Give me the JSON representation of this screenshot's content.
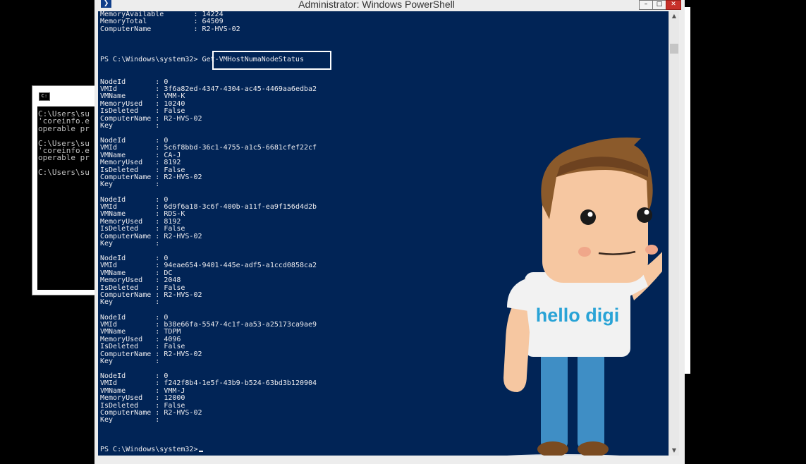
{
  "window": {
    "title": "Administrator: Windows PowerShell",
    "icon": "powershell-icon",
    "controls": [
      "minimize-icon",
      "maximize-icon",
      "close-icon"
    ]
  },
  "background_window": {
    "icon": "cmd-icon",
    "lines": [
      "C:\\Users\\su",
      "'coreinfo.e",
      "operable pr",
      "",
      "C:\\Users\\su",
      "'coreinfo.e",
      "operable pr",
      "",
      "C:\\Users\\su"
    ]
  },
  "console": {
    "background_color": "#012456",
    "text_color": "#eeedf0",
    "header_lines": [
      "MemoryAvailable       : 14224",
      "MemoryTotal           : 64509",
      "ComputerName          : R2-HVS-02"
    ],
    "prompt": "PS C:\\Windows\\system32>",
    "command": "Get-VMHostNumaNodeStatus",
    "records": [
      {
        "NodeId": "0",
        "VMId": "3f6a82ed-4347-4304-ac45-4469aa6edba2",
        "VMName": "VMM-K",
        "MemoryUsed": "10240",
        "IsDeleted": "False",
        "ComputerName": "R2-HVS-02",
        "Key": ""
      },
      {
        "NodeId": "0",
        "VMId": "5c6f8bbd-36c1-4755-a1c5-6681cfef22cf",
        "VMName": "CA-J",
        "MemoryUsed": "8192",
        "IsDeleted": "False",
        "ComputerName": "R2-HVS-02",
        "Key": ""
      },
      {
        "NodeId": "0",
        "VMId": "6d9f6a18-3c6f-400b-a11f-ea9f156d4d2b",
        "VMName": "RDS-K",
        "MemoryUsed": "8192",
        "IsDeleted": "False",
        "ComputerName": "R2-HVS-02",
        "Key": ""
      },
      {
        "NodeId": "0",
        "VMId": "94eae654-9401-445e-adf5-a1ccd0858ca2",
        "VMName": "DC",
        "MemoryUsed": "2048",
        "IsDeleted": "False",
        "ComputerName": "R2-HVS-02",
        "Key": ""
      },
      {
        "NodeId": "0",
        "VMId": "b38e66fa-5547-4c1f-aa53-a25173ca9ae9",
        "VMName": "TDPM",
        "MemoryUsed": "4096",
        "IsDeleted": "False",
        "ComputerName": "R2-HVS-02",
        "Key": ""
      },
      {
        "NodeId": "0",
        "VMId": "f242f8b4-1e5f-43b9-b524-63bd3b120904",
        "VMName": "VMM-J",
        "MemoryUsed": "12000",
        "IsDeleted": "False",
        "ComputerName": "R2-HVS-02",
        "Key": ""
      }
    ],
    "final_prompt": "PS C:\\Windows\\system32>"
  },
  "mascot": {
    "shirt_text": "hello digi",
    "shirt_text_color": "#29a3d6"
  },
  "scrollbar": {
    "up_icon": "chevron-up-icon",
    "down_icon": "chevron-down-icon"
  }
}
